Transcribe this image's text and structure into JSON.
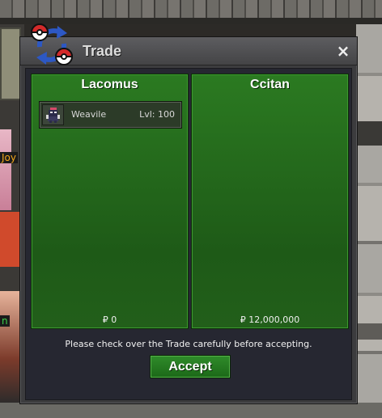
{
  "background": {
    "side_label_1": "Joy",
    "side_label_2": "n"
  },
  "window": {
    "title": "Trade",
    "close_label": "×",
    "icon": "pokeball-swap-icon"
  },
  "trade": {
    "left": {
      "name": "Lacomus",
      "money": "₽ 0",
      "items": [
        {
          "icon": "weavile-sprite-icon",
          "name": "Weavile",
          "level": "Lvl: 100"
        }
      ]
    },
    "right": {
      "name": "Ccitan",
      "money": "₽ 12,000,000",
      "items": []
    },
    "notice": "Please check over the Trade carefully before accepting.",
    "accept_label": "Accept"
  },
  "colors": {
    "panel_green": "#2b7a21",
    "window_bg": "#3c3c3e",
    "body_bg": "#262731",
    "accept_green": "#2f8c2a",
    "pokeball_red": "#d32a2a",
    "arrow_blue": "#2d58c4"
  }
}
